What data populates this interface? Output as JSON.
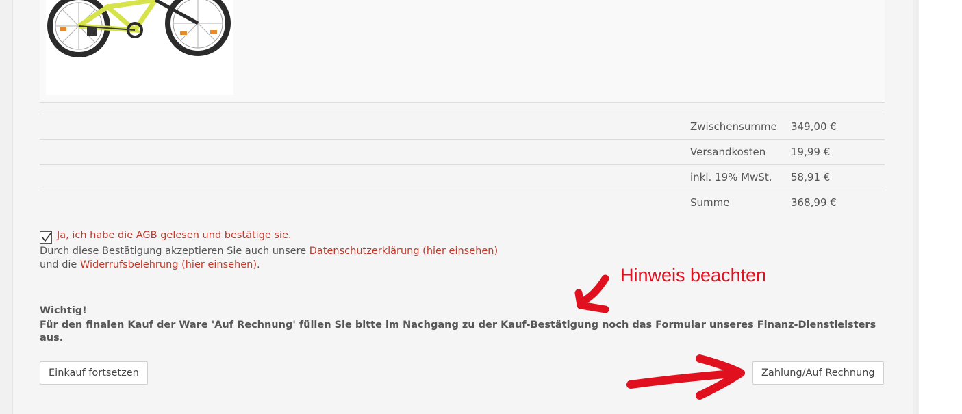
{
  "summary": {
    "rows": [
      {
        "label": "Zwischensumme",
        "value": "349,00 €"
      },
      {
        "label": "Versandkosten",
        "value": "19,99 €"
      },
      {
        "label": "inkl. 19% MwSt.",
        "value": "58,91 €"
      },
      {
        "label": "Summe",
        "value": "368,99 €"
      }
    ]
  },
  "consent": {
    "checked": true,
    "agb_label": "Ja, ich habe die AGB gelesen und bestätige sie.",
    "line1_prefix": "Durch diese Bestätigung akzeptieren Sie auch unsere ",
    "privacy_link": "Datenschutzerklärung (hier einsehen)",
    "line2_prefix": "und die ",
    "withdrawal_link": "Widerrufsbelehrung (hier einsehen)",
    "line2_suffix": "."
  },
  "notice": {
    "title": "Wichtig!",
    "text": "Für den finalen Kauf der Ware 'Auf Rechnung' füllen Sie bitte im Nachgang zu der Kauf-Bestätigung noch das Formular unseres Finanz-Dienstleisters aus."
  },
  "buttons": {
    "continue_label": "Einkauf fortsetzen",
    "pay_label": "Zahlung/Auf Rechnung"
  },
  "annotation": {
    "hint_text": "Hinweis beachten",
    "color": "#e0101e"
  },
  "colors": {
    "link": "#c0392b",
    "text": "#555555"
  }
}
